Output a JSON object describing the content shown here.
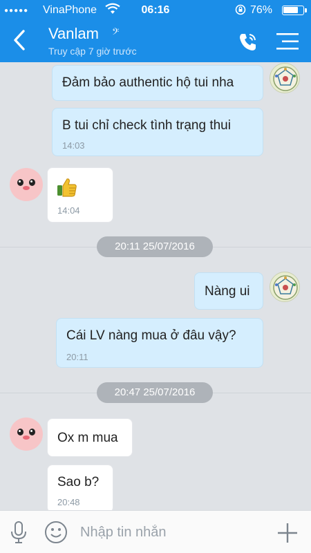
{
  "status_bar": {
    "signal": "●●●●●",
    "carrier": "VinaPhone",
    "time": "06:16",
    "battery_percent": "76%",
    "battery_level": 0.76
  },
  "header": {
    "contact_name": "Vanlam",
    "last_seen": "Truy cập 7 giờ trước",
    "icons": [
      "back-chevron-icon",
      "voice-mark-icon",
      "phone-call-icon",
      "menu-icon"
    ],
    "color": "#1b8ee8"
  },
  "messages": [
    {
      "side": "out",
      "text": "Đảm bảo authentic hộ tui nha"
    },
    {
      "side": "out",
      "text": "B tui chỉ check tình trạng thui",
      "time": "14:03"
    },
    {
      "side": "in",
      "emoji": "👍",
      "time": "14:04"
    },
    {
      "date": "20:11 25/07/2016"
    },
    {
      "side": "out",
      "text": "Nàng ui"
    },
    {
      "side": "out",
      "text": "Cái LV nàng mua ở đâu vậy?",
      "time": "20:11"
    },
    {
      "date": "20:47 25/07/2016"
    },
    {
      "side": "in",
      "text": "Ox m mua"
    },
    {
      "side": "in",
      "text": "Sao b?",
      "time": "20:48"
    }
  ],
  "composer": {
    "placeholder": "Nhập tin nhắn",
    "icons": [
      "microphone-icon",
      "emoji-icon",
      "plus-icon"
    ]
  },
  "colors": {
    "outgoing_bubble": "#d5eefe",
    "incoming_bubble": "#ffffff",
    "chat_background": "#dfe2e6",
    "date_pill": "#aeb3b9"
  }
}
